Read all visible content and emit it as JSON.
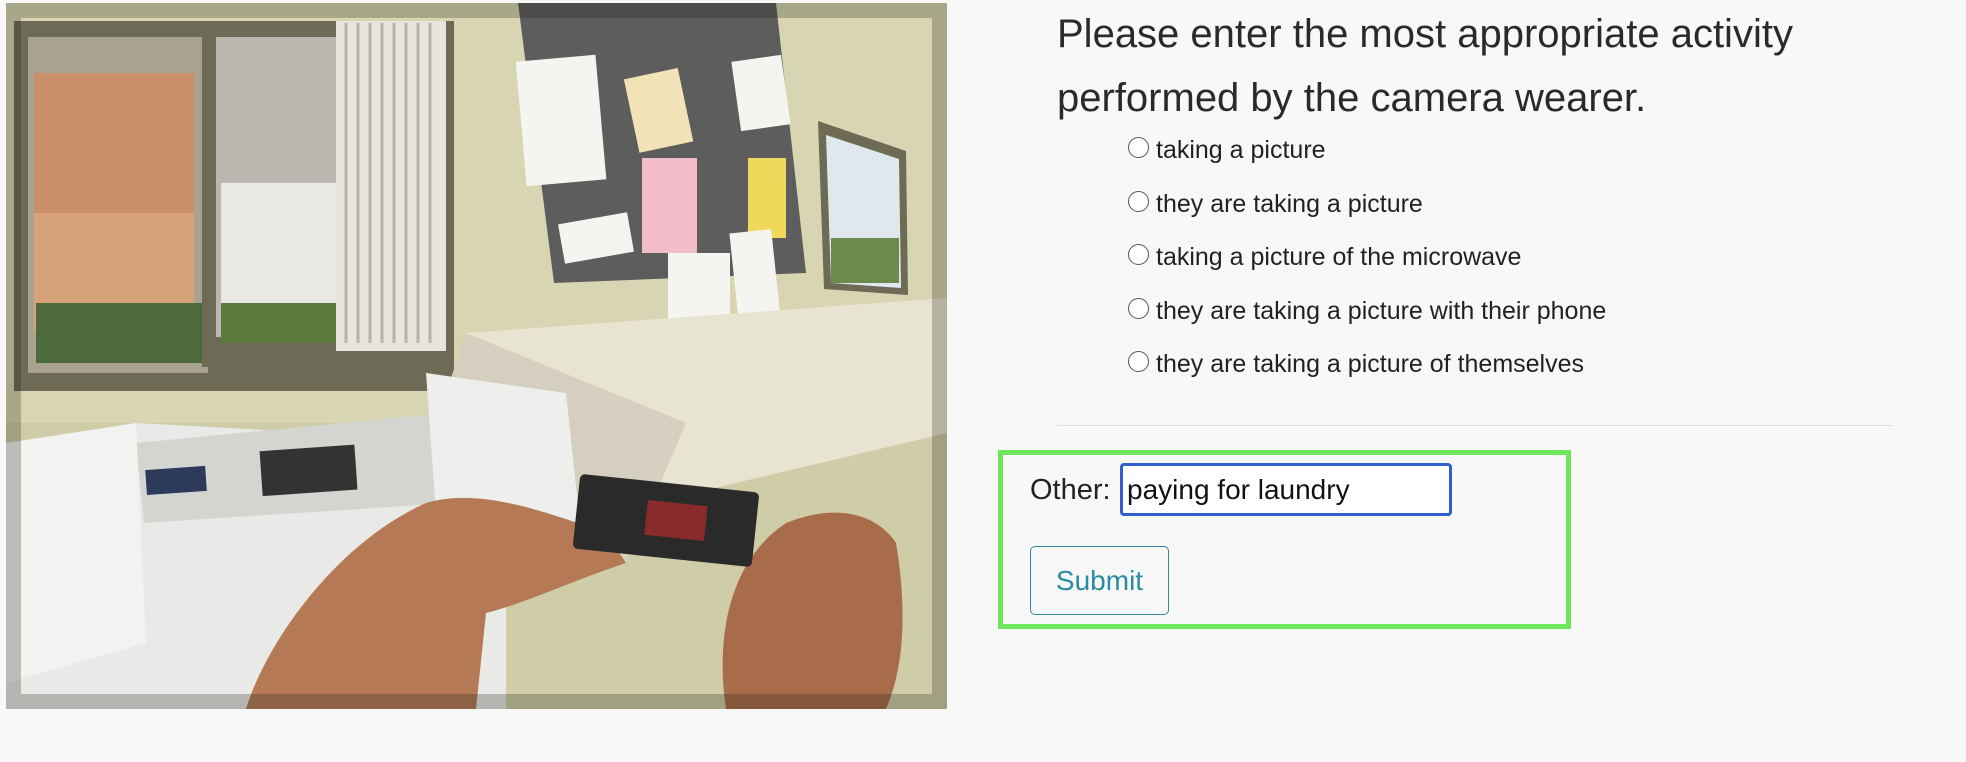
{
  "video": {
    "description_icon": "camera-frame-image"
  },
  "question": {
    "title": "Please enter the most appropriate activity performed by the camera wearer.",
    "options": [
      {
        "label": "taking a picture"
      },
      {
        "label": "they are taking a picture"
      },
      {
        "label": "taking a picture of the microwave"
      },
      {
        "label": "they are taking a picture with their phone"
      },
      {
        "label": "they are taking a picture of themselves"
      }
    ]
  },
  "other": {
    "label": "Other:",
    "value": "paying for laundry"
  },
  "submit": {
    "label": "Submit"
  },
  "colors": {
    "highlight_border": "#6ee85a",
    "input_focus_border": "#2f5fd0",
    "submit_text": "#2a8ba3"
  }
}
